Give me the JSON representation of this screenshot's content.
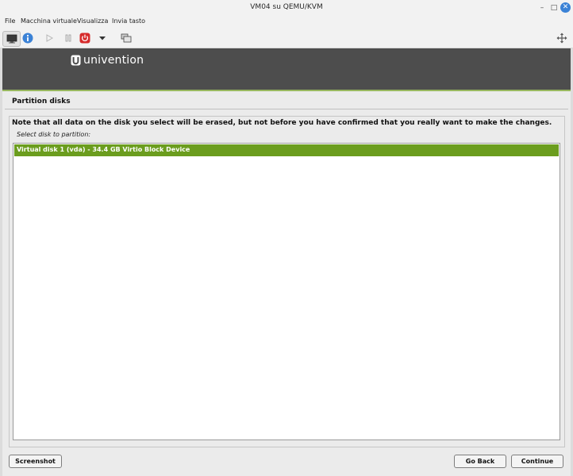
{
  "window": {
    "title": "VM04 su QEMU/KVM",
    "minimize_glyph": "–",
    "maximize_glyph": "□",
    "close_glyph": "✕"
  },
  "menubar": {
    "items": [
      {
        "label": "File"
      },
      {
        "label": "Macchina virtuale"
      },
      {
        "label": "Visualizza"
      },
      {
        "label": "Invia tasto"
      }
    ]
  },
  "toolbar": {
    "icons": [
      "monitor-icon",
      "info-icon",
      "play-icon",
      "pause-icon",
      "power-icon",
      "chevron-down-icon",
      "snapshot-icon",
      "fullscreen-icon"
    ],
    "info_glyph": "i",
    "power_color": "#d62b2b",
    "info_color": "#3b82d6"
  },
  "banner": {
    "logo_text": "univention",
    "accent_color": "#98b75f"
  },
  "installer": {
    "heading": "Partition disks",
    "note": "Note that all data on the disk you select will be erased, but not before you have confirmed that you really want to make the changes.",
    "prompt": "Select disk to partition:",
    "disks": [
      {
        "label": "Virtual disk 1 (vda) - 34.4 GB Virtio Block Device",
        "selected": true
      }
    ],
    "selection_color": "#6b9d1e"
  },
  "buttons": {
    "screenshot": "Screenshot",
    "go_back": "Go Back",
    "continue": "Continue"
  }
}
